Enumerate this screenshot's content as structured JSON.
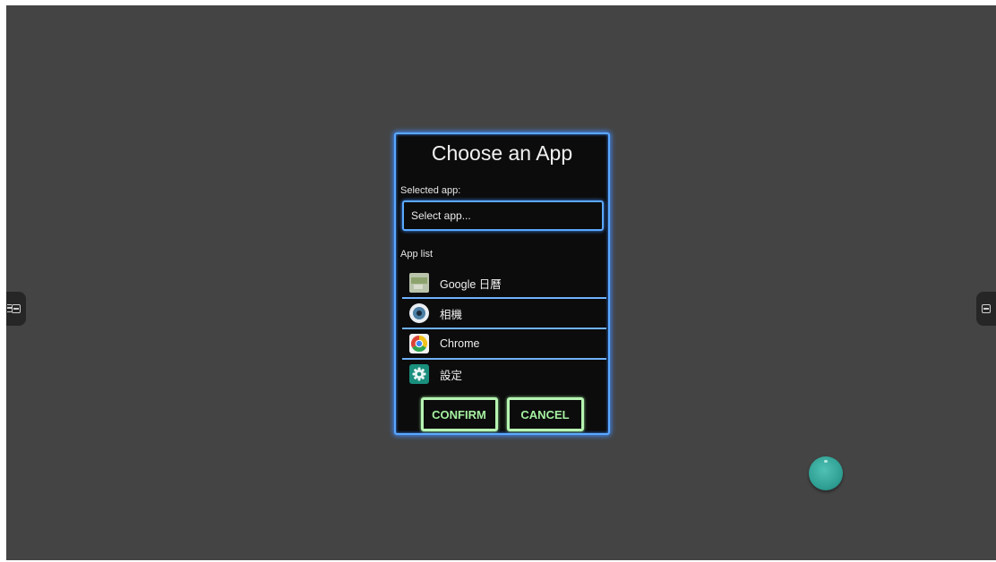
{
  "dialog": {
    "title": "Choose an App",
    "selected_label": "Selected app:",
    "select_placeholder": "Select app...",
    "list_label": "App list",
    "apps": [
      {
        "name": "Google 日曆",
        "icon": "calendar-icon"
      },
      {
        "name": "相機",
        "icon": "camera-icon"
      },
      {
        "name": "Chrome",
        "icon": "chrome-icon"
      },
      {
        "name": "設定",
        "icon": "settings-icon"
      }
    ],
    "confirm_label": "CONFIRM",
    "cancel_label": "CANCEL"
  },
  "colors": {
    "background": "#444444",
    "dialog_bg": "#0c0c0c",
    "accent_blue": "#5aa8ff",
    "button_green": "#a5f0a0",
    "float_ball": "#2e9e92"
  }
}
